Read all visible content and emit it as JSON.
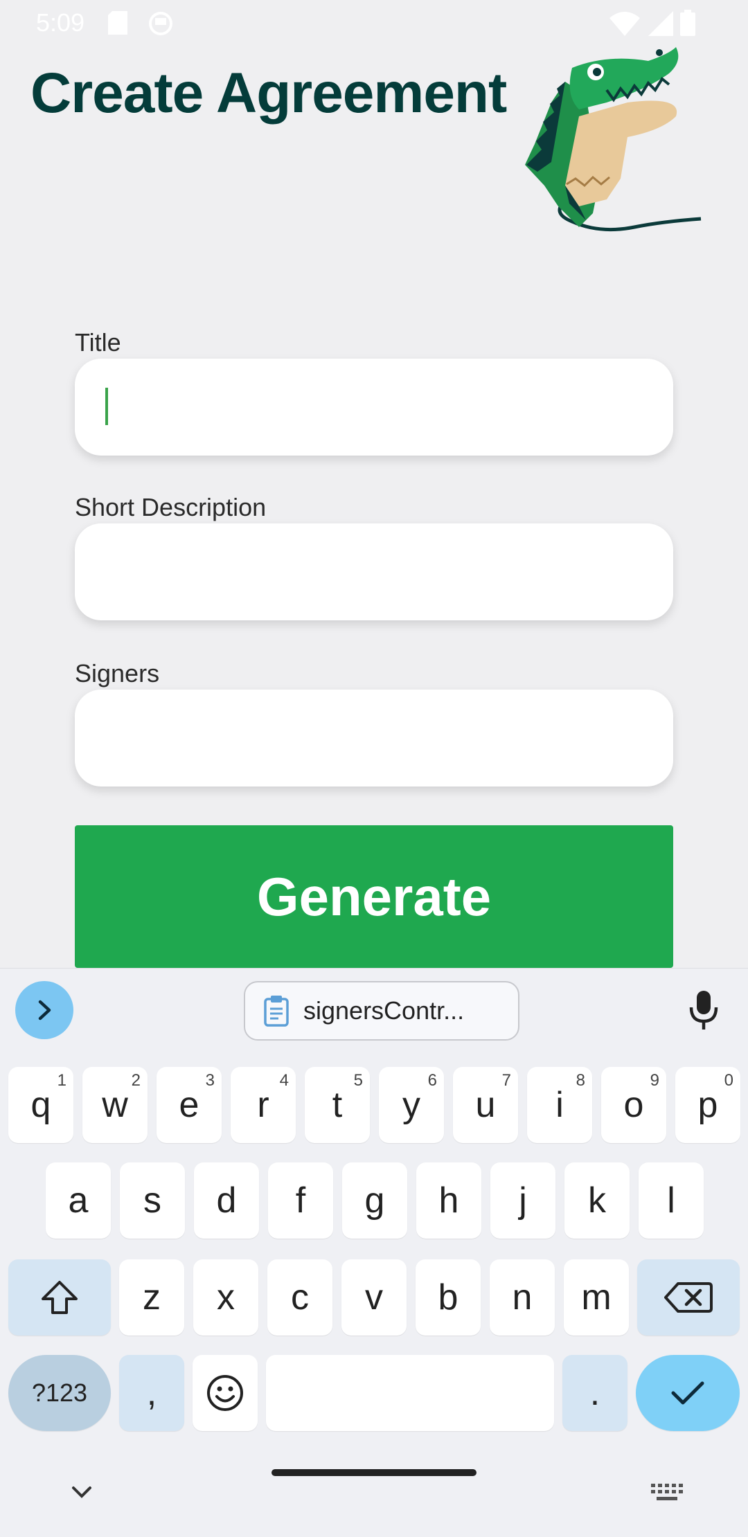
{
  "status_bar": {
    "time": "5:09"
  },
  "header": {
    "title": "Create Agreement"
  },
  "form": {
    "title_label": "Title",
    "title_value": "",
    "description_label": "Short Description",
    "description_value": "",
    "signers_label": "Signers",
    "signers_value": "",
    "generate_label": "Generate"
  },
  "keyboard": {
    "clipboard_suggestion": "signersContr...",
    "row1": [
      {
        "key": "q",
        "hint": "1"
      },
      {
        "key": "w",
        "hint": "2"
      },
      {
        "key": "e",
        "hint": "3"
      },
      {
        "key": "r",
        "hint": "4"
      },
      {
        "key": "t",
        "hint": "5"
      },
      {
        "key": "y",
        "hint": "6"
      },
      {
        "key": "u",
        "hint": "7"
      },
      {
        "key": "i",
        "hint": "8"
      },
      {
        "key": "o",
        "hint": "9"
      },
      {
        "key": "p",
        "hint": "0"
      }
    ],
    "row2": [
      "a",
      "s",
      "d",
      "f",
      "g",
      "h",
      "j",
      "k",
      "l"
    ],
    "row3": [
      "z",
      "x",
      "c",
      "v",
      "b",
      "n",
      "m"
    ],
    "symbols_label": "?123",
    "comma": ",",
    "period": "."
  },
  "colors": {
    "title": "#043c3a",
    "accent_green": "#1fa84f",
    "keyboard_accent": "#7fd0f7"
  }
}
